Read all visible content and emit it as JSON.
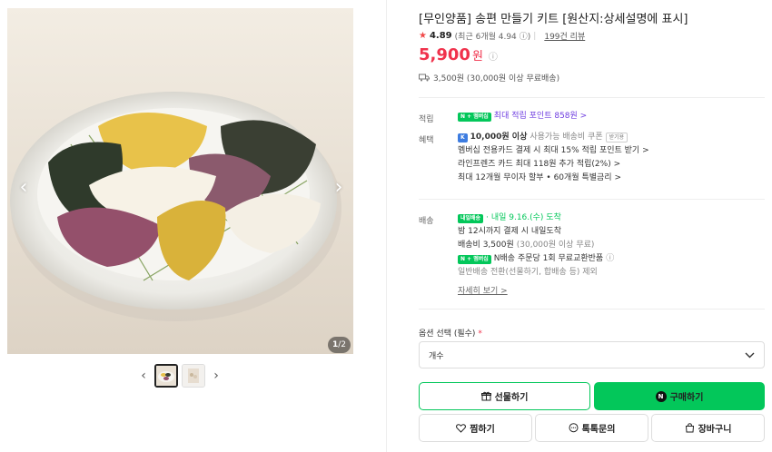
{
  "gallery": {
    "counter_current": "1",
    "counter_total": "/2",
    "prev_arrow": "‹",
    "next_arrow": "›",
    "thumb_prev": "‹",
    "thumb_next": "›"
  },
  "product": {
    "title": "[무인양품] 송편 만들기 키트 [원산지:상세설명에 표시]",
    "rating": "4.89",
    "rating_recent": "(최근 6개월 4.94",
    "rating_info": "ⓘ)",
    "reviews": "199건 리뷰",
    "price": "5,900",
    "currency": "원",
    "shipping": "3,500원 (30,000원 이상 무료배송)"
  },
  "points": {
    "label": "적립",
    "badge": "N + 멤버십",
    "text": "최대 적립 포인트 858원 >"
  },
  "benefits": {
    "label": "혜택",
    "coupon_amount": "10,000원 이상",
    "coupon_text": "사용가능 배송비 쿠폰",
    "coupon_chip": "받기용",
    "lines": [
      "멤버십 전용카드 결제 시 최대 15% 적립 포인트 받기 >",
      "라인프렌즈 카드 최대 118원 추가 적립(2%) >",
      "최대 12개월 무이자 할부 • 60개월 특별금리 >"
    ]
  },
  "delivery": {
    "label": "배송",
    "badge": "내일배송",
    "arrival": "· 내일 9.16.(수) 도착",
    "line1": "밤 12시까지 결제 시 내일도착",
    "fee": "배송비 3,500원",
    "fee_note": "(30,000원 이상 무료)",
    "return_badge": "N + 멤버십",
    "return_text": "N배송 주문당 1회 무료교환반품",
    "return_info": "ⓘ",
    "excluded": "일반배송 전환(선물하기, 합배송 등) 제외",
    "detail_link": "자세히 보기 >"
  },
  "option": {
    "label": "옵션 선택 (필수)",
    "required_mark": "*",
    "selected": "개수"
  },
  "buttons": {
    "gift": "선물하기",
    "buy": "구매하기",
    "zzim": "찜하기",
    "talk": "톡톡문의",
    "cart": "장바구니"
  },
  "colors": {
    "accent_green": "#03c75a",
    "price_red": "#f0324c",
    "points_purple": "#6f3ee0"
  },
  "icons": [
    "star-icon",
    "truck-icon",
    "gift-icon",
    "heart-icon",
    "chat-icon",
    "cart-icon",
    "chevron-down-icon"
  ]
}
